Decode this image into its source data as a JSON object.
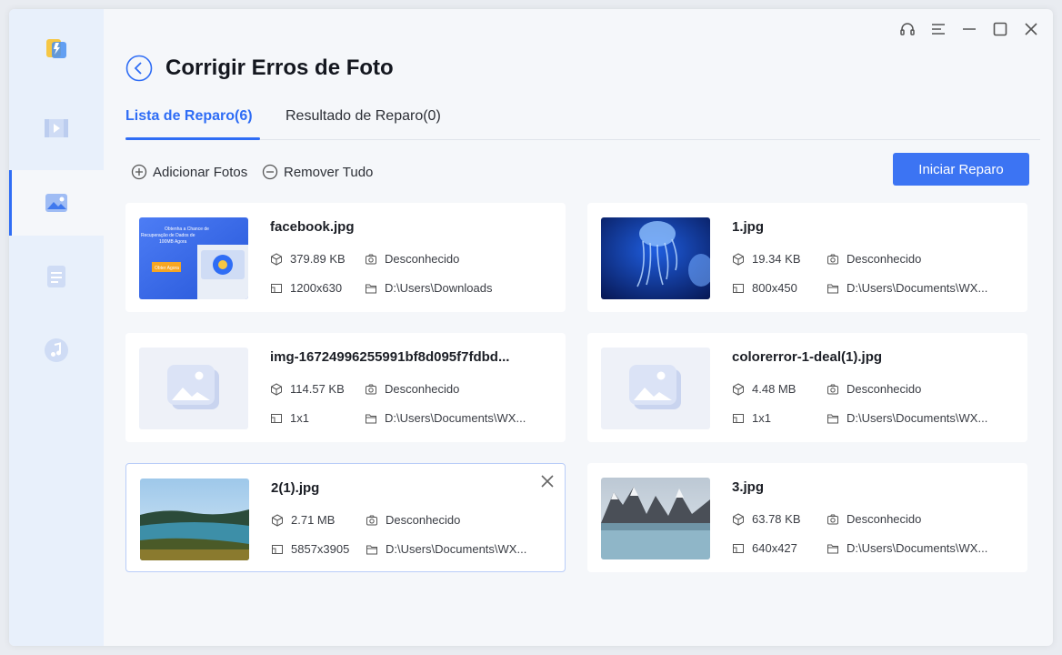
{
  "app": {
    "title": "Corrigir Erros de Foto"
  },
  "tabs": [
    {
      "label": "Lista de Reparo(6)",
      "active": true
    },
    {
      "label": "Resultado de Reparo(0)",
      "active": false
    }
  ],
  "toolbar": {
    "add_label": "Adicionar Fotos",
    "remove_label": "Remover Tudo",
    "start_label": "Iniciar Reparo"
  },
  "sidebar": {
    "items": [
      {
        "icon": "video-icon"
      },
      {
        "icon": "photo-icon",
        "active": true
      },
      {
        "icon": "document-icon"
      },
      {
        "icon": "music-icon"
      }
    ]
  },
  "window_controls": [
    "headset-icon",
    "menu-icon",
    "minimize-icon",
    "maximize-icon",
    "close-icon"
  ],
  "files": [
    {
      "name": "facebook.jpg",
      "size": "379.89 KB",
      "camera": "Desconhecido",
      "dimensions": "1200x630",
      "path": "D:\\Users\\Downloads",
      "thumb": "facebook"
    },
    {
      "name": "1.jpg",
      "size": "19.34 KB",
      "camera": "Desconhecido",
      "dimensions": "800x450",
      "path": "D:\\Users\\Documents\\WX...",
      "thumb": "jellyfish"
    },
    {
      "name": "img-16724996255991bf8d095f7fdbd...",
      "size": "114.57 KB",
      "camera": "Desconhecido",
      "dimensions": "1x1",
      "path": "D:\\Users\\Documents\\WX...",
      "thumb": "placeholder"
    },
    {
      "name": "colorerror-1-deal(1).jpg",
      "size": "4.48 MB",
      "camera": "Desconhecido",
      "dimensions": "1x1",
      "path": "D:\\Users\\Documents\\WX...",
      "thumb": "placeholder"
    },
    {
      "name": "2(1).jpg",
      "size": "2.71 MB",
      "camera": "Desconhecido",
      "dimensions": "5857x3905",
      "path": "D:\\Users\\Documents\\WX...",
      "thumb": "lake",
      "selected": true
    },
    {
      "name": "3.jpg",
      "size": "63.78 KB",
      "camera": "Desconhecido",
      "dimensions": "640x427",
      "path": "D:\\Users\\Documents\\WX...",
      "thumb": "mountains"
    }
  ],
  "thumb_text": {
    "line1": "Obtenha a Chance de",
    "line2": "Recuperação de Dados de",
    "line3": "100MB Agora",
    "button": "Obter Agora"
  },
  "colors": {
    "accent": "#2f6df5",
    "button": "#3c74f3",
    "sidebar": "#e8f0fb"
  }
}
